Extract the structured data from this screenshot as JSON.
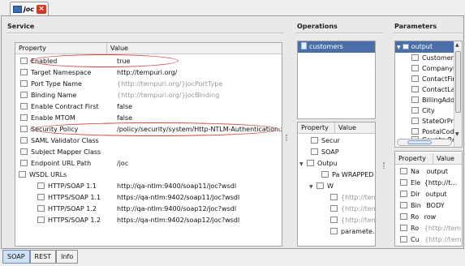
{
  "tab": {
    "title": "joc"
  },
  "bottom_tabs": [
    {
      "label": "SOAP"
    },
    {
      "label": "REST"
    },
    {
      "label": "Info"
    }
  ],
  "service": {
    "header": "Service",
    "columns": {
      "property": "Property",
      "value": "Value"
    },
    "rows": [
      {
        "label": "Enabled",
        "value": "true"
      },
      {
        "label": "Target Namespace",
        "value": "http://tempuri.org/"
      },
      {
        "label": "Port Type Name",
        "value": "{http://tempuri.org/}jocPortType"
      },
      {
        "label": "Binding Name",
        "value": "{http://tempuri.org/}jocBinding"
      },
      {
        "label": "Enable Contract First",
        "value": "false"
      },
      {
        "label": "Enable MTOM",
        "value": "false"
      },
      {
        "label": "Security Policy",
        "value": "/policy/security/system/Http-NTLM-Authentication.xml"
      },
      {
        "label": "SAML Validator Class",
        "value": ""
      },
      {
        "label": "Subject Mapper Class",
        "value": ""
      },
      {
        "label": "Endpoint URL Path",
        "value": "/joc"
      },
      {
        "label": "WSDL URLs",
        "value": ""
      },
      {
        "label": "HTTP/SOAP 1.1",
        "value": "http://qa-ntlm:9400/soap11/joc?wsdl"
      },
      {
        "label": "HTTPS/SOAP 1.1",
        "value": "https://qa-ntlm:9402/soap11/joc?wsdl"
      },
      {
        "label": "HTTP/SOAP 1.2",
        "value": "http://qa-ntlm:9400/soap12/joc?wsdl"
      },
      {
        "label": "HTTPS/SOAP 1.2",
        "value": "https://qa-ntlm:9402/soap12/joc?wsdl"
      }
    ]
  },
  "operations": {
    "header": "Operations",
    "items": [
      {
        "label": "customers"
      }
    ],
    "columns": {
      "property": "Property",
      "value": "Value"
    },
    "rows": [
      {
        "label": "Secur",
        "value": ""
      },
      {
        "label": "SOAP",
        "value": ""
      },
      {
        "label": "Outpu",
        "value": ""
      },
      {
        "label": "Pa",
        "value": "WRAPPED"
      },
      {
        "label": "W",
        "value": ""
      },
      {
        "label": "",
        "value": "{http://tempu"
      },
      {
        "label": "",
        "value": "{http://tempu"
      },
      {
        "label": "",
        "value": "{http://tempu"
      },
      {
        "label": "",
        "value": "paramete..."
      }
    ]
  },
  "parameters": {
    "header": "Parameters",
    "root": "output",
    "items": [
      {
        "label": "Customerl"
      },
      {
        "label": "CompanyN"
      },
      {
        "label": "ContactFirs"
      },
      {
        "label": "ContactLas"
      },
      {
        "label": "BillingAddr"
      },
      {
        "label": "City"
      },
      {
        "label": "StateOrPro"
      },
      {
        "label": "PostalCod"
      },
      {
        "label": "CountryRe"
      }
    ],
    "columns": {
      "property": "Property",
      "value": "Value"
    },
    "rows": [
      {
        "label": "Na",
        "value": "output"
      },
      {
        "label": "Ele",
        "value": "{http://t..."
      },
      {
        "label": "Dir",
        "value": "output"
      },
      {
        "label": "Bin",
        "value": "BODY"
      },
      {
        "label": "Ro",
        "value": "row"
      },
      {
        "label": "Ro",
        "value": "{http://tem"
      },
      {
        "label": "Cu",
        "value": "{http://tem"
      }
    ]
  }
}
